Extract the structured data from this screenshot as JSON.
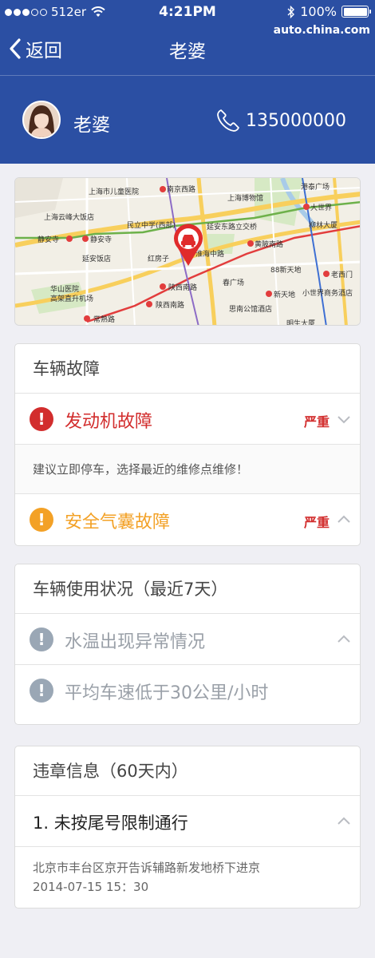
{
  "status_bar": {
    "carrier": "512er",
    "time": "4:21PM",
    "battery": "100%",
    "watermark": "auto.china.com"
  },
  "nav": {
    "back_label": "返回",
    "title": "老婆"
  },
  "profile": {
    "name": "老婆",
    "phone": "135000000"
  },
  "map": {
    "labels": {
      "l1": "南京西路",
      "l2": "上海市儿童医院",
      "l3": "上海博物馆",
      "l4": "港泰广场",
      "l5": "大世界",
      "l6": "上海云峰大饭店",
      "l7": "民立中学(西部)",
      "l8": "延安东路立交桥",
      "l9": "柳林大厦",
      "l10": "静安寺",
      "l11": "静安寺",
      "l12": "黄陂南路",
      "l13": "延安饭店",
      "l14": "红房子",
      "l15": "淮海中路",
      "l16": "88新天地",
      "l17": "老西门",
      "l18": "华山医院",
      "l19": "高架直升机场",
      "l20": "陕西南路",
      "l21": "春广场",
      "l22": "新天地",
      "l23": "小世界商务酒店",
      "l24": "陕西南路",
      "l25": "思南公馆酒店",
      "l26": "常熟路",
      "l27": "明生大厦"
    }
  },
  "fault_card": {
    "title": "车辆故障",
    "engine": {
      "label": "发动机故障",
      "severity": "严重"
    },
    "advice": "建议立即停车，选择最近的维修点维修！",
    "airbag": {
      "label": "安全气囊故障",
      "severity": "严重"
    }
  },
  "usage_card": {
    "title": "车辆使用状况（最近7天）",
    "item1": "水温出现异常情况",
    "item2": "平均车速低于30公里/小时"
  },
  "violation_card": {
    "title": "违章信息（60天内）",
    "item_title": "1. 未按尾号限制通行",
    "location": "北京市丰台区京开告诉辅路新发地桥下进京",
    "time": "2014-07-15 15：30"
  },
  "colors": {
    "header": "#2b4fa3",
    "red": "#d22d2d",
    "orange": "#f3a126",
    "grey_badge": "#9aa7b5"
  }
}
